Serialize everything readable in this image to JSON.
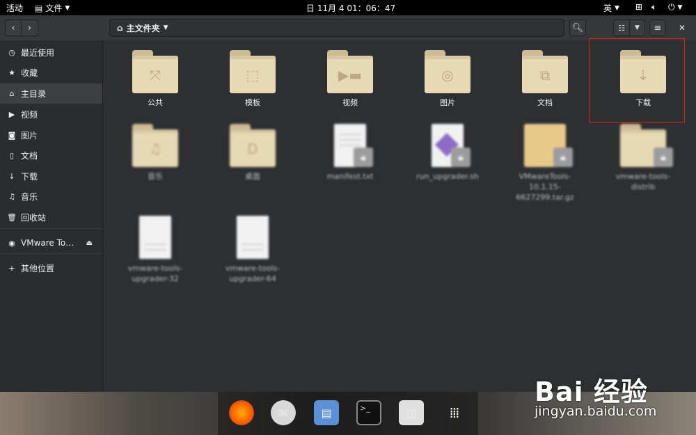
{
  "topbar": {
    "activities": "活动",
    "app_menu": "文件",
    "clock": "日 11月 4  01：06：47",
    "input_method": "英"
  },
  "headerbar": {
    "path_label": "主文件夹"
  },
  "sidebar": {
    "items": [
      {
        "label": "最近使用",
        "icon": "clock-icon"
      },
      {
        "label": "收藏",
        "icon": "star-icon"
      },
      {
        "label": "主目录",
        "icon": "home-icon"
      },
      {
        "label": "视频",
        "icon": "video-icon"
      },
      {
        "label": "图片",
        "icon": "camera-icon"
      },
      {
        "label": "文档",
        "icon": "document-icon"
      },
      {
        "label": "下载",
        "icon": "download-icon"
      },
      {
        "label": "音乐",
        "icon": "music-icon"
      },
      {
        "label": "回收站",
        "icon": "trash-icon"
      }
    ],
    "device": "VMware To…",
    "other_locations": "其他位置"
  },
  "files": {
    "row1": [
      "公共",
      "模板",
      "视频",
      "图片",
      "文档",
      "下载"
    ],
    "row2": [
      "音乐",
      "桌面",
      "manifest.txt",
      "run_upgrader.sh",
      "VMwareTools-10.1.15-6627299.tar.gz",
      "vmware-tools-distrib"
    ],
    "row3": [
      "vmware-tools-upgrader-32",
      "vmware-tools-upgrader-64"
    ]
  },
  "watermark": {
    "brand": "Bai 经验",
    "url": "jingyan.baidu.com"
  },
  "colors": {
    "highlight": "#e0201a",
    "folder": "#e7d8b6"
  }
}
